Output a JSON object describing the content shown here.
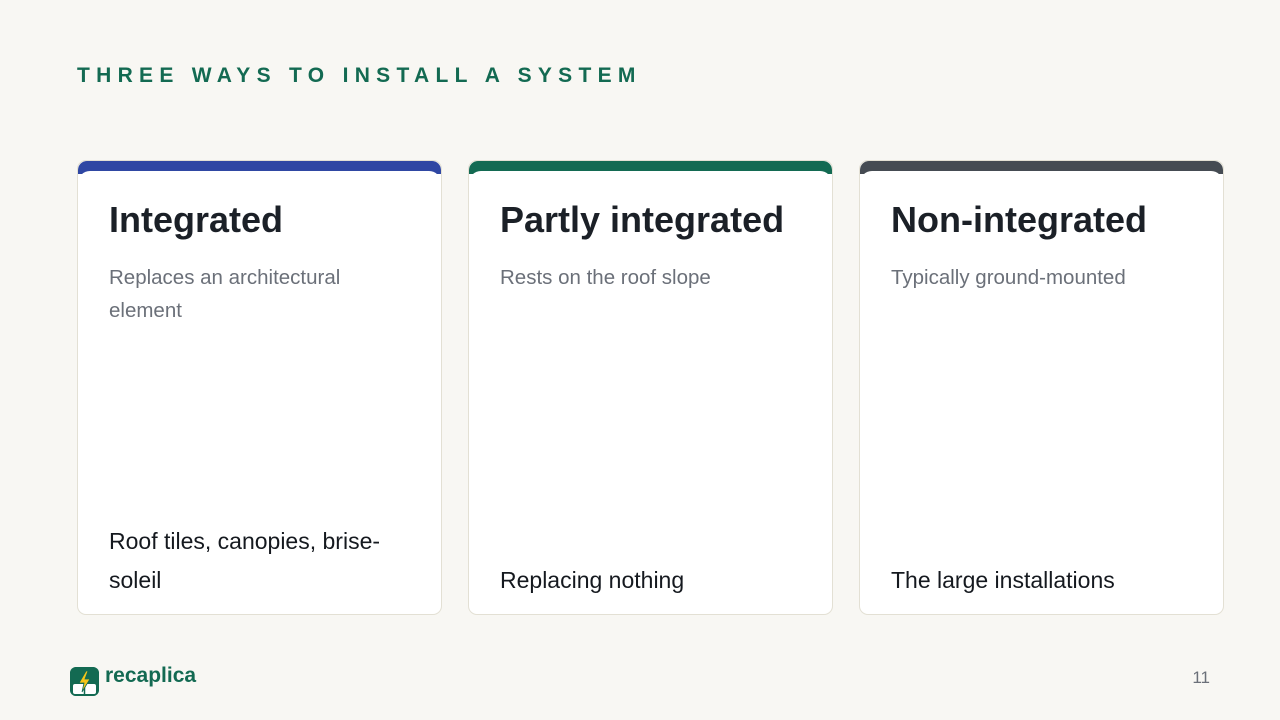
{
  "slide": {
    "eyebrow": "THREE WAYS TO INSTALL A SYSTEM",
    "page_number": "11"
  },
  "cards": [
    {
      "title": "Integrated",
      "subtitle": "Replaces an architectural element",
      "example": "Roof tiles, canopies, brise-soleil",
      "accent_color": "#2f47a3"
    },
    {
      "title": "Partly integrated",
      "subtitle": "Rests on the roof slope",
      "example": "Replacing nothing",
      "accent_color": "#136a52"
    },
    {
      "title": "Non-integrated",
      "subtitle": "Typically ground-mounted",
      "example": "The large installations",
      "accent_color": "#454b52"
    }
  ],
  "brand": {
    "name": "recaplica",
    "color": "#136a52",
    "icon": "lightning-bolt-icon"
  }
}
